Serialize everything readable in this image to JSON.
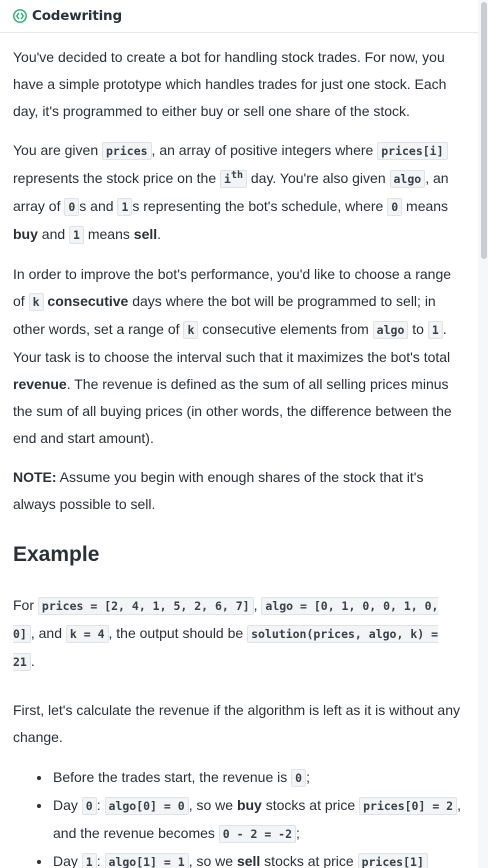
{
  "brand": {
    "name": "Codewriting",
    "icon": "code-brackets-icon",
    "accent": "#1fb26b"
  },
  "intro": {
    "text": "You've decided to create a bot for handling stock trades. For now, you have a simple prototype which handles trades for just one stock. Each day, it's programmed to either buy or sell one share of the stock."
  },
  "given": {
    "t1": "You are given ",
    "c_prices": "prices",
    "t2": ", an array of positive integers where ",
    "c_prices_i": "prices[i]",
    "t3": " represents the stock price on the ",
    "c_i": "i",
    "sup": "th",
    "t4": " day. You're also given ",
    "c_algo": "algo",
    "t5": ", an array of ",
    "c_zero": "0",
    "t6": "s and ",
    "c_one": "1",
    "t7": "s representing the bot's schedule, where ",
    "c_zero2": "0",
    "t8": " means ",
    "b_buy": "buy",
    "t9": " and ",
    "c_one2": "1",
    "t10": " means ",
    "b_sell": "sell",
    "t11": "."
  },
  "improve": {
    "t1": "In order to improve the bot's performance, you'd like to choose a range of ",
    "c_k": "k",
    "t2": " ",
    "b_consecutive": "consecutive",
    "t3": " days where the bot will be programmed to sell; in other words, set a range of ",
    "c_k2": "k",
    "t4": " consecutive elements from ",
    "c_algo": "algo",
    "t5": " to ",
    "c_one": "1",
    "t6": ". Your task is to choose the interval such that it maximizes the bot's total ",
    "b_revenue": "revenue",
    "t7": ". The revenue is defined as the sum of all selling prices minus the sum of all buying prices (in other words, the difference between the end and start amount)."
  },
  "note": {
    "label": "NOTE:",
    "text": " Assume you begin with enough shares of the stock that it's always possible to sell."
  },
  "example": {
    "heading": "Example",
    "t1": "For ",
    "c_prices": "prices = [2, 4, 1, 5, 2, 6, 7]",
    "t2": ", ",
    "c_algo": "algo = [0, 1, 0, 0, 1, 0, 0]",
    "t3": ", and ",
    "c_k": "k = 4",
    "t4": ", the output should be ",
    "c_solution": "solution(prices, algo, k) = 21",
    "t5": "."
  },
  "first": {
    "text": "First, let's calculate the revenue if the algorithm is left as it is without any change."
  },
  "steps": [
    {
      "t1": "Before the trades start, the revenue is ",
      "c1": "0",
      "t2": ";"
    },
    {
      "t1": "Day ",
      "c1": "0",
      "t2": ": ",
      "c2": "algo[0] = 0",
      "t3": ", so we ",
      "b1": "buy",
      "t4": " stocks at price ",
      "c3": "prices[0] = 2",
      "t5": ", and the revenue becomes ",
      "c4": "0 - 2 = -2",
      "t6": ";"
    },
    {
      "t1": "Day ",
      "c1": "1",
      "t2": ": ",
      "c2": "algo[1] = 1",
      "t3": ", so we ",
      "b1": "sell",
      "t4": " stocks at price ",
      "c3": "prices[1]",
      "t5": ""
    }
  ]
}
